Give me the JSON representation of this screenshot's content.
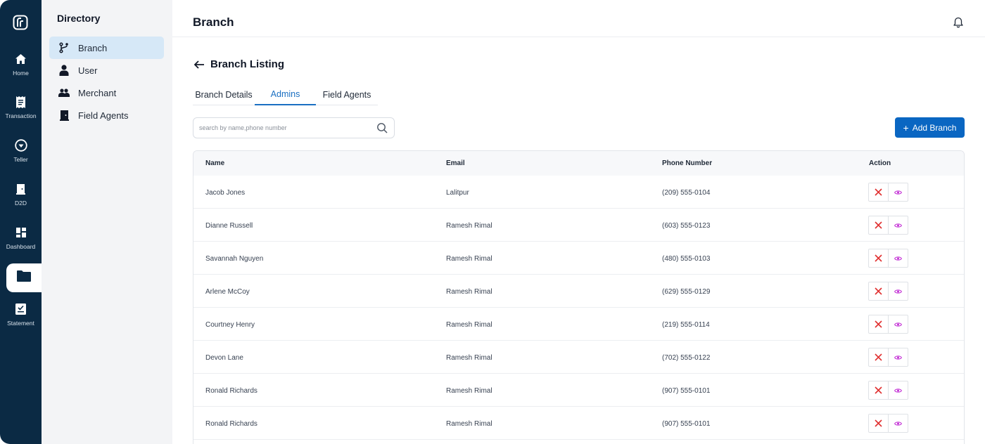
{
  "rail": {
    "items": [
      {
        "label": "Home",
        "icon": "home-icon"
      },
      {
        "label": "Transaction",
        "icon": "receipt-icon"
      },
      {
        "label": "Teller",
        "icon": "teller-icon"
      },
      {
        "label": "D2D",
        "icon": "door-icon"
      },
      {
        "label": "Dashboard",
        "icon": "dashboard-icon"
      },
      {
        "label": "",
        "icon": "folder-icon"
      },
      {
        "label": "Statement",
        "icon": "statement-icon"
      }
    ]
  },
  "directory": {
    "title": "Directory",
    "items": [
      {
        "label": "Branch",
        "icon": "branch-icon"
      },
      {
        "label": "User",
        "icon": "user-icon"
      },
      {
        "label": "Merchant",
        "icon": "merchant-icon"
      },
      {
        "label": "Field Agents",
        "icon": "field-agent-icon"
      }
    ]
  },
  "header": {
    "title": "Branch"
  },
  "subheader": {
    "title": "Branch Listing"
  },
  "tabs": [
    {
      "label": "Branch Details"
    },
    {
      "label": "Admins"
    },
    {
      "label": "Field Agents"
    }
  ],
  "search": {
    "placeholder": "search by name,phone number",
    "value": ""
  },
  "add_button": {
    "label": "Add Branch"
  },
  "table": {
    "columns": [
      "Name",
      "Email",
      "Phone Number",
      "Action"
    ],
    "rows": [
      {
        "name": "Jacob Jones",
        "email": "Lalitpur",
        "phone": "(209) 555-0104"
      },
      {
        "name": "Dianne Russell",
        "email": "Ramesh Rimal",
        "phone": "(603) 555-0123"
      },
      {
        "name": "Savannah Nguyen",
        "email": "Ramesh Rimal",
        "phone": "(480) 555-0103"
      },
      {
        "name": "Arlene McCoy",
        "email": "Ramesh Rimal",
        "phone": "(629) 555-0129"
      },
      {
        "name": "Courtney Henry",
        "email": "Ramesh Rimal",
        "phone": "(219) 555-0114"
      },
      {
        "name": "Devon Lane",
        "email": "Ramesh Rimal",
        "phone": "(702) 555-0122"
      },
      {
        "name": "Ronald Richards",
        "email": "Ramesh Rimal",
        "phone": "(907) 555-0101"
      },
      {
        "name": "Ronald Richards",
        "email": "Ramesh Rimal",
        "phone": "(907) 555-0101"
      }
    ]
  },
  "colors": {
    "rail": "#0b2a44",
    "accent": "#0a66c2",
    "danger": "#e03131",
    "view": "#c026d3"
  }
}
